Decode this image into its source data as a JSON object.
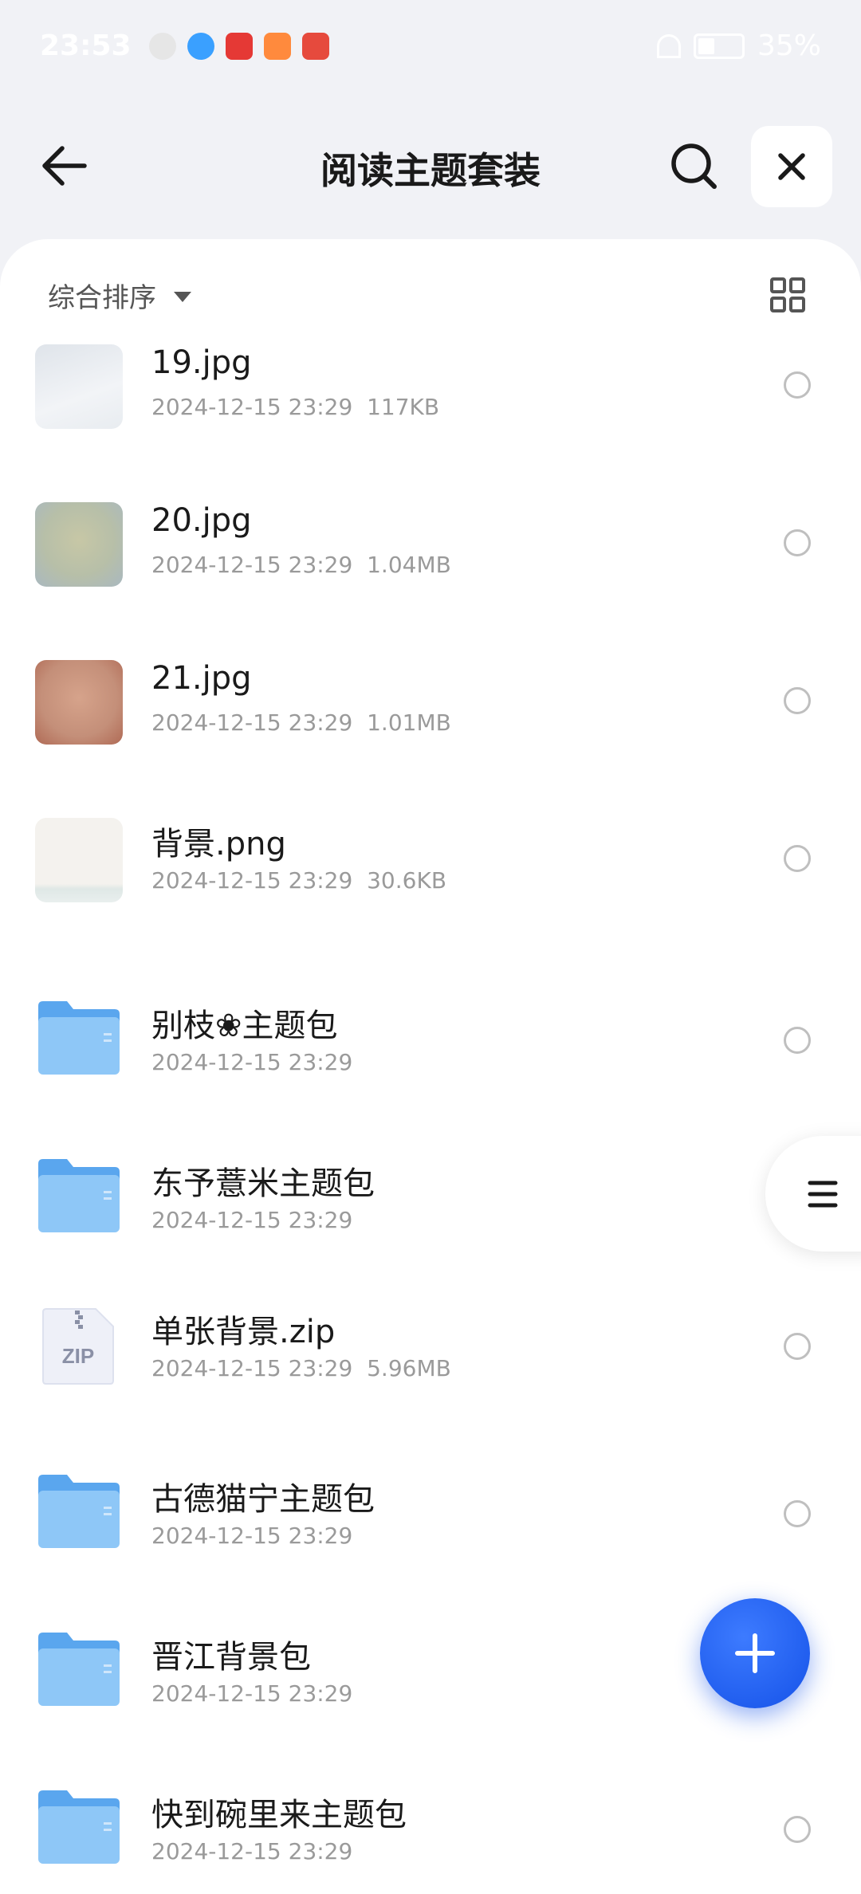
{
  "status_bar": {
    "time": "23:53",
    "battery": "35%"
  },
  "header": {
    "title": "阅读主题套装"
  },
  "toolbar": {
    "sort_label": "综合排序"
  },
  "files": [
    {
      "name": "19.jpg",
      "meta": "2024-12-15 23:29  117KB",
      "kind": "image",
      "colors": [
        "#dfe4ea",
        "#f2f4f7"
      ]
    },
    {
      "name": "20.jpg",
      "meta": "2024-12-15 23:29  1.04MB",
      "kind": "image",
      "colors": [
        "#b7bfa8",
        "#c7c7a6"
      ]
    },
    {
      "name": "21.jpg",
      "meta": "2024-12-15 23:29  1.01MB",
      "kind": "image",
      "colors": [
        "#c48f79",
        "#d6a38b"
      ]
    },
    {
      "name": "背景.png",
      "meta": "2024-12-15 23:29  30.6KB",
      "kind": "image",
      "colors": [
        "#f4f2ee",
        "#dfe8e6"
      ]
    },
    {
      "name": "别枝❀主题包",
      "meta": "2024-12-15 23:29",
      "kind": "folder"
    },
    {
      "name": "东予薏米主题包",
      "meta": "2024-12-15 23:29",
      "kind": "folder"
    },
    {
      "name": "单张背景.zip",
      "meta": "2024-12-15 23:29  5.96MB",
      "kind": "zip",
      "badge": "ZIP"
    },
    {
      "name": "古德猫宁主题包",
      "meta": "2024-12-15 23:29",
      "kind": "folder"
    },
    {
      "name": "晋江背景包",
      "meta": "2024-12-15 23:29",
      "kind": "folder"
    },
    {
      "name": "快到碗里来主题包",
      "meta": "2024-12-15 23:29",
      "kind": "folder"
    }
  ],
  "colors": {
    "accent": "#1552e8",
    "folder": "#7fbdf5",
    "background": "#f1f2f6"
  }
}
